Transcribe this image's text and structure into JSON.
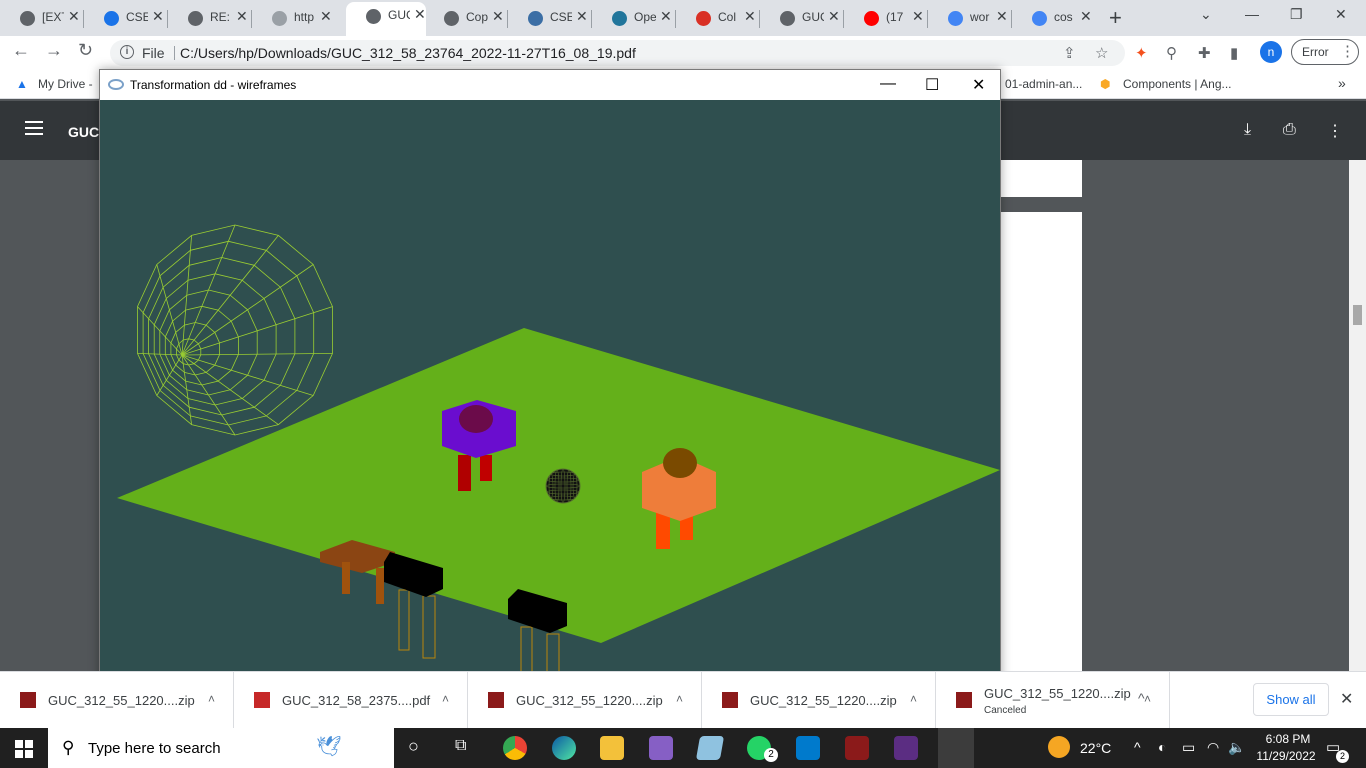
{
  "browser": {
    "tabs": [
      {
        "label": "[EXT",
        "fav_color": "#5f6368",
        "active": false
      },
      {
        "label": "CSE",
        "fav_color": "#1a73e8",
        "active": false
      },
      {
        "label": "RE:",
        "fav_color": "#5f6368",
        "active": false
      },
      {
        "label": "http",
        "fav_color": "#9aa0a6",
        "active": false
      },
      {
        "label": "GUC",
        "fav_color": "#5f6368",
        "active": true
      },
      {
        "label": "Cop",
        "fav_color": "#5f6368",
        "active": false
      },
      {
        "label": "CSE",
        "fav_color": "#3b6ea5",
        "active": false
      },
      {
        "label": "Ope",
        "fav_color": "#21759b",
        "active": false
      },
      {
        "label": "Col",
        "fav_color": "#d93025",
        "active": false
      },
      {
        "label": "GUC",
        "fav_color": "#5f6368",
        "active": false
      },
      {
        "label": "(17",
        "fav_color": "#ff0000",
        "active": false
      },
      {
        "label": "wor",
        "fav_color": "#4285f4",
        "active": false
      },
      {
        "label": "cos",
        "fav_color": "#4285f4",
        "active": false
      }
    ],
    "tab_close": "✕",
    "new_tab": "+",
    "address": {
      "scheme": "File",
      "url": "C:/Users/hp/Downloads/GUC_312_58_23764_2022-11-27T16_08_19.pdf"
    },
    "profile_initial": "n",
    "error_label": "Error",
    "bookmarks": {
      "left": "My Drive - ",
      "mid": "01-admin-an...",
      "right": "Components | Ang...",
      "more": "»"
    }
  },
  "pdf": {
    "title": "GUC_"
  },
  "app_window": {
    "title": "Transformation dd - wireframes"
  },
  "downloads": {
    "items": [
      {
        "name": "GUC_312_55_1220....zip",
        "status": ""
      },
      {
        "name": "GUC_312_58_2375....pdf",
        "status": ""
      },
      {
        "name": "GUC_312_55_1220....zip",
        "status": ""
      },
      {
        "name": "GUC_312_55_1220....zip",
        "status": ""
      },
      {
        "name": "GUC_312_55_1220....zip",
        "status": "Canceled"
      }
    ],
    "show_all": "Show all"
  },
  "taskbar": {
    "search_placeholder": "Type here to search",
    "temperature": "22°C",
    "time": "6:08 PM",
    "date": "11/29/2022",
    "whatsapp_badge": "2",
    "notification_count": "2"
  },
  "colors": {
    "scene_bg": "#2f4f4f",
    "ground": "#64b01a",
    "wireframe_umbrella": "#9acd32",
    "robot_purple": "#6a0dcf",
    "robot_orange": "#ee7d3a",
    "table_brown": "#8b4513",
    "bench_black": "#000000"
  }
}
